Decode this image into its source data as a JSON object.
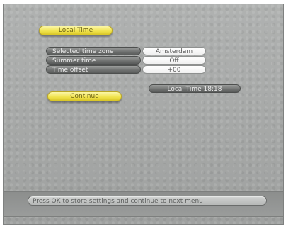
{
  "header": {
    "title": "Local Time"
  },
  "settings": [
    {
      "label": "Selected time zone",
      "value": "Amsterdam"
    },
    {
      "label": "Summer time",
      "value": "Off"
    },
    {
      "label": "Time offset",
      "value": "+00"
    }
  ],
  "local_time_display": "Local Time 18:18",
  "actions": {
    "continue_label": "Continue"
  },
  "footer": {
    "hint": "Press OK to store settings and continue to next menu"
  },
  "colors": {
    "highlight": "#f0e24a",
    "panel": "#a9abaa",
    "label_pill": "#6f7170",
    "value_pill": "#ffffff"
  }
}
